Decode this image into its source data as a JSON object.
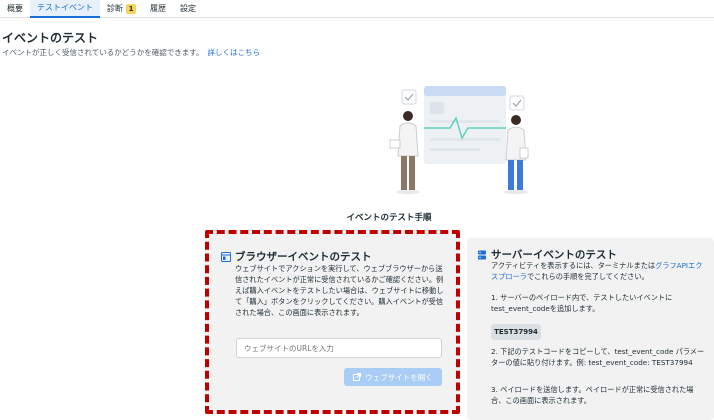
{
  "tabs": [
    {
      "label": "概要"
    },
    {
      "label": "テストイベント"
    },
    {
      "label": "診断",
      "badge": "1"
    },
    {
      "label": "履歴"
    },
    {
      "label": "設定"
    }
  ],
  "page": {
    "title": "イベントのテスト",
    "subtitle": "イベントが正しく受信されているかどうかを確認できます。",
    "learn_more": "詳しくはこちら",
    "steps_heading": "イベントのテスト手順"
  },
  "browser_card": {
    "title": "ブラウザーイベントのテスト",
    "description": "ウェブサイトでアクションを実行して、ウェブブラウザーから送信されたイベントが正常に受信されているかご確認ください。例えば購入イベントをテストしたい場合は、ウェブサイトに移動して「購入」ボタンをクリックしてください。購入イベントが受信された場合、この画面に表示されます。",
    "url_placeholder": "ウェブサイトのURLを入力",
    "open_button": "ウェブサイトを開く"
  },
  "server_card": {
    "title": "サーバーイベントのテスト",
    "intro_prefix": "アクティビティを表示するには、ターミナルまたは",
    "intro_link": "グラフAPIエクスプローラ",
    "intro_suffix": "でこれらの手順を完了してください。",
    "step1": "1. サーバーのペイロード内で、テストしたいイベントにtest_event_codeを追加します。",
    "code": "TEST37994",
    "step2": "2. 下記のテストコードをコピーして、test_event_code パラメーターの値に貼り付けます。例: test_event_code: TEST37994",
    "step3": "3. ペイロードを送信します。ペイロードが正常に受信された場合、この画面に表示されます。"
  },
  "colors": {
    "accent": "#1a6ed8",
    "highlight_border": "#c00000",
    "badge": "#f6d45b",
    "card_bg": "#f2f2f2"
  }
}
